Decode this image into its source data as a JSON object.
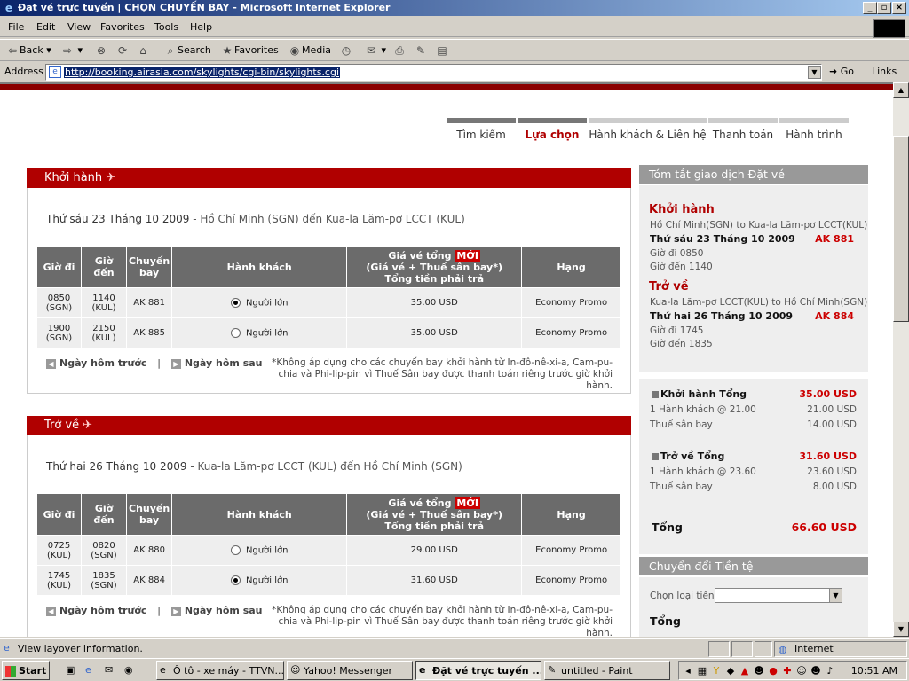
{
  "window": {
    "title": "Đặt vé trực tuyến | CHỌN CHUYẾN BAY - Microsoft Internet Explorer"
  },
  "menu": [
    "File",
    "Edit",
    "View",
    "Favorites",
    "Tools",
    "Help"
  ],
  "toolbar": {
    "back": "Back",
    "search": "Search",
    "favorites": "Favorites",
    "media": "Media"
  },
  "address": {
    "label": "Address",
    "url": "http://booking.airasia.com/skylights/cgi-bin/skylights.cgi",
    "go": "Go",
    "links": "Links"
  },
  "steps": [
    "Tìm kiếm",
    "Lựa chọn",
    "Hành khách & Liên hệ",
    "Thanh toán",
    "Hành trình"
  ],
  "depart": {
    "header": "Khởi hành",
    "date_bold": "Thứ sáu 23 Tháng 10 2009",
    "date_rest": " - Hồ Chí Minh (SGN) đến Kua-la Lăm-pơ LCCT (KUL)",
    "rows": [
      {
        "dep": "0850",
        "dep_code": "(SGN)",
        "arr": "1140",
        "arr_code": "(KUL)",
        "flight": "AK 881",
        "pax": "Người lớn",
        "price": "35.00 USD",
        "cls": "Economy Promo",
        "selected": true
      },
      {
        "dep": "1900",
        "dep_code": "(SGN)",
        "arr": "2150",
        "arr_code": "(KUL)",
        "flight": "AK 885",
        "pax": "Người lớn",
        "price": "35.00 USD",
        "cls": "Economy Promo",
        "selected": false
      }
    ]
  },
  "ret": {
    "header": "Trở về",
    "date_bold": "Thứ hai 26 Tháng 10 2009",
    "date_rest": " - Kua-la Lăm-pơ LCCT (KUL) đến Hồ Chí Minh (SGN)",
    "rows": [
      {
        "dep": "0725",
        "dep_code": "(KUL)",
        "arr": "0820",
        "arr_code": "(SGN)",
        "flight": "AK 880",
        "pax": "Người lớn",
        "price": "29.00 USD",
        "cls": "Economy Promo",
        "selected": false
      },
      {
        "dep": "1745",
        "dep_code": "(KUL)",
        "arr": "1835",
        "arr_code": "(SGN)",
        "flight": "AK 884",
        "pax": "Người lớn",
        "price": "31.60 USD",
        "cls": "Economy Promo",
        "selected": true
      }
    ]
  },
  "table_headers": {
    "dep": "Giờ đi",
    "arr1": "Giờ",
    "arr2": "đến",
    "flt1": "Chuyến",
    "flt2": "bay",
    "pax": "Hành khách",
    "price1": "Giá vé tổng",
    "moi": "MỚI",
    "price2": "(Giá vé + Thuế sân bay*)",
    "price3": "Tổng tiền phải trả",
    "cls": "Hạng"
  },
  "nav": {
    "prev": "Ngày hôm trước",
    "sep": "|",
    "next": "Ngày hôm sau"
  },
  "note": "*Không áp dụng cho các chuyến bay khởi hành từ In-đô-nê-xi-a, Cam-pu-chia và Phi-lip-pin vì Thuế Sân bay được thanh toán riêng trước giờ khởi hành.",
  "summary": {
    "header": "Tóm tắt giao dịch Đặt vé",
    "dep_title": "Khởi hành",
    "dep_route": "Hồ Chí Minh(SGN) to Kua-la Lăm-pơ LCCT(KUL)",
    "dep_date": "Thứ sáu 23 Tháng 10 2009",
    "dep_flight": "AK 881",
    "dep_time": "Giờ đi 0850",
    "dep_arr": "Giờ đến 1140",
    "ret_title": "Trở về",
    "ret_route": "Kua-la Lăm-pơ LCCT(KUL) to Hồ Chí Minh(SGN)",
    "ret_date": "Thứ hai 26 Tháng 10 2009",
    "ret_flight": "AK 884",
    "ret_time": "Giờ đi 1745",
    "ret_arr": "Giờ đến 1835",
    "dep_total_label": "Khởi hành Tổng",
    "dep_total": "35.00 USD",
    "dep_pax": "1 Hành khách @ 21.00",
    "dep_pax_amt": "21.00 USD",
    "dep_tax": "Thuế sân bay",
    "dep_tax_amt": "14.00 USD",
    "ret_total_label": "Trở về Tổng",
    "ret_total": "31.60 USD",
    "ret_pax": "1 Hành khách @ 23.60",
    "ret_pax_amt": "23.60 USD",
    "ret_tax": "Thuế sân bay",
    "ret_tax_amt": "8.00 USD",
    "total_label": "Tổng",
    "total": "66.60 USD"
  },
  "currency": {
    "header": "Chuyển đổi Tiền tệ",
    "label": "Chọn loại tiền:",
    "total": "Tổng"
  },
  "status": {
    "text": "View layover information.",
    "zone": "Internet"
  },
  "taskbar": {
    "start": "Start",
    "tasks": [
      "Ô tô - xe máy - TTVN...",
      "Yahoo! Messenger",
      "Đặt vé trực tuyến ...",
      "untitled - Paint"
    ],
    "clock": "10:51 AM"
  }
}
